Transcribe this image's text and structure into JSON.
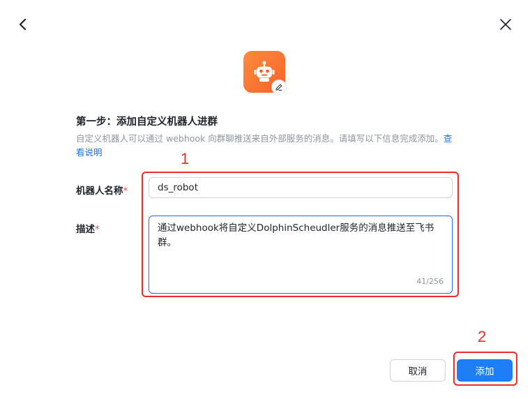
{
  "header": {
    "back_icon": "chevron-left-icon",
    "close_icon": "close-icon"
  },
  "avatar": {
    "icon": "robot-icon",
    "edit_icon": "pencil-icon",
    "bg_color": "#f5642a"
  },
  "step": {
    "title": "第一步：添加自定义机器人进群",
    "description": "自定义机器人可以通过 webhook 向群聊推送来自外部服务的消息。请填写以下信息完成添加。",
    "help_link": "查看说明"
  },
  "form": {
    "name_label": "机器人名称",
    "name_value": "ds_robot",
    "desc_label": "描述",
    "desc_value": "通过webhook将自定义DolphinScheudler服务的消息推送至飞书群。",
    "desc_counter": "41/256",
    "required_mark": "*"
  },
  "annotations": {
    "marker_1": "1",
    "marker_2": "2",
    "color": "#ee2b2b"
  },
  "footer": {
    "cancel_label": "取消",
    "add_label": "添加",
    "accent_color": "#1e7ef7"
  }
}
